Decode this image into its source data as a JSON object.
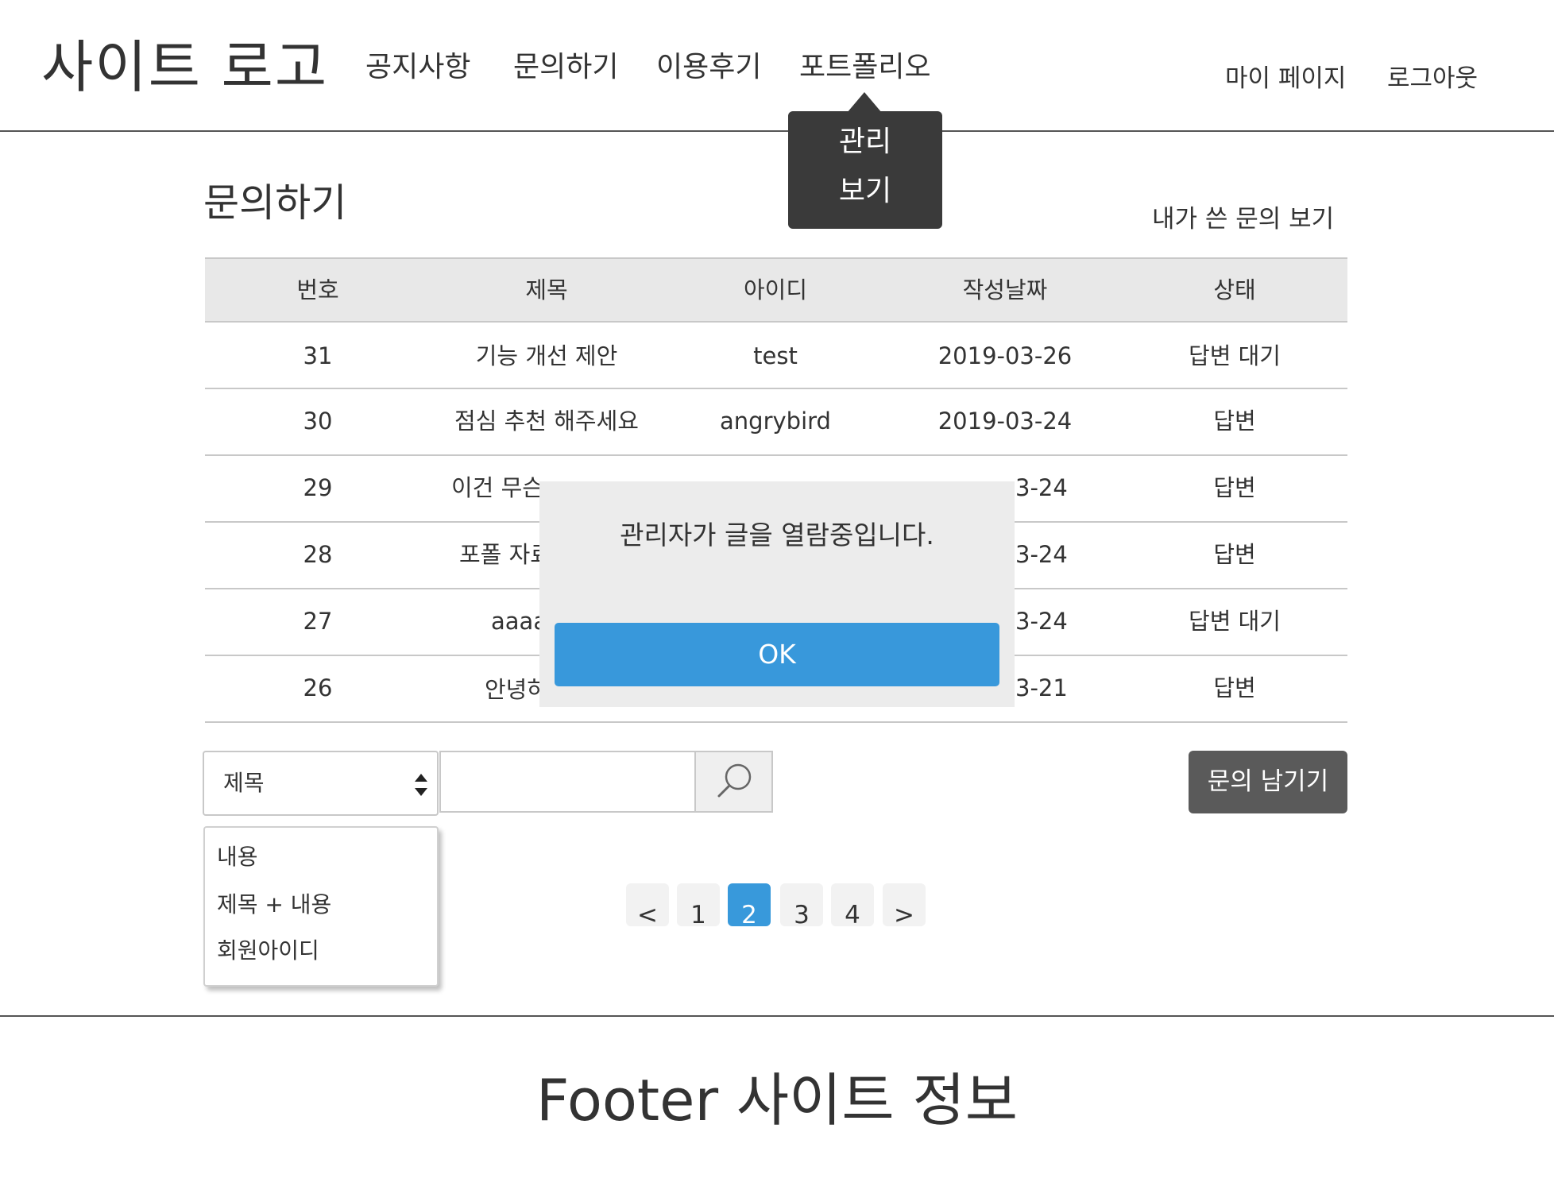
{
  "header": {
    "logo": "사이트 로고",
    "nav": [
      "공지사항",
      "문의하기",
      "이용후기",
      "포트폴리오"
    ],
    "user_menu": [
      "마이 페이지",
      "로그아웃"
    ]
  },
  "admin_menu": {
    "items": [
      "관리",
      "보기"
    ]
  },
  "main": {
    "title": "문의하기",
    "my_inquiries_link": "내가 쓴 문의 보기"
  },
  "table": {
    "headers": [
      "번호",
      "제목",
      "아이디",
      "작성날짜",
      "상태"
    ],
    "rows": [
      {
        "no": "31",
        "title": "기능 개선 제안",
        "id": "test",
        "date": "2019-03-26",
        "status": "답변 대기"
      },
      {
        "no": "30",
        "title": "점심 추천 해주세요",
        "id": "angrybird",
        "date": "2019-03-24",
        "status": "답변"
      },
      {
        "no": "29",
        "title": "이건 무슨 ㄱ",
        "id": "",
        "date": "3-24",
        "status": "답변"
      },
      {
        "no": "28",
        "title": "포폴 자료",
        "id": "",
        "date": "3-24",
        "status": "답변"
      },
      {
        "no": "27",
        "title": "aaaa",
        "id": "",
        "date": "3-24",
        "status": "답변 대기"
      },
      {
        "no": "26",
        "title": "안녕하",
        "id": "",
        "date": "3-21",
        "status": "답변"
      }
    ]
  },
  "search": {
    "selected": "제목",
    "input_value": "",
    "options": [
      "내용",
      "제목 + 내용",
      "회원아이디"
    ]
  },
  "write_button": "문의 남기기",
  "pagination": {
    "prev": "<",
    "pages": [
      "1",
      "2",
      "3",
      "4"
    ],
    "current": "2",
    "next": ">"
  },
  "footer": {
    "text": "Footer 사이트 정보"
  },
  "alert": {
    "message": "관리자가 글을 열람중입니다.",
    "ok_label": "OK"
  },
  "colors": {
    "accent": "#3898db",
    "dark": "#3a3a3a",
    "button_dark": "#5a5a5a"
  }
}
